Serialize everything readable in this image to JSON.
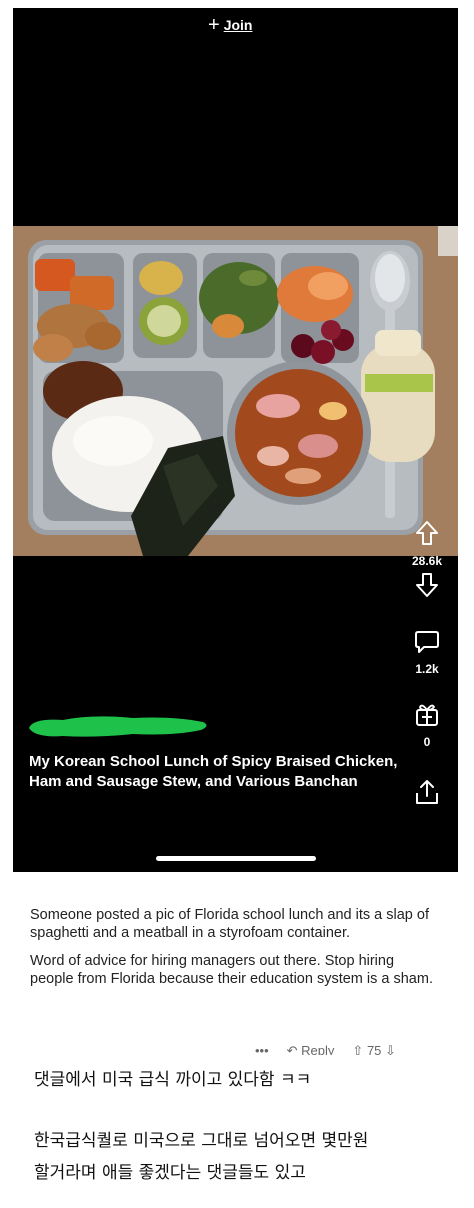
{
  "top": {
    "join_icon": "plus-icon",
    "join_label": "Join"
  },
  "post": {
    "caption": "My Korean School Lunch of Spicy Braised Chicken, Ham and Sausage Stew, and Various Banchan",
    "upvotes": "28.6k",
    "comments": "1.2k",
    "awards": "0"
  },
  "comment": {
    "para1": "Someone posted a pic of Florida school lunch and its a slap of spaghetti and a meatball in a styrofoam container.",
    "para2": "Word of advice for hiring managers out there. Stop hiring people from Florida because their education system is a sham.",
    "more": "•••",
    "reply": "Reply",
    "votes": "75"
  },
  "korean": {
    "line1": "댓글에서 미국 급식 까이고 있다함 ㅋㅋ",
    "line2": "한국급식퀄로 미국으로 그대로 넘어오면 몇만원",
    "line3": "할거라며 애들 좋겠다는 댓글들도 있고"
  },
  "colors": {
    "background": "#000000",
    "text_light": "#ffffff",
    "redaction": "#1ec24a"
  }
}
